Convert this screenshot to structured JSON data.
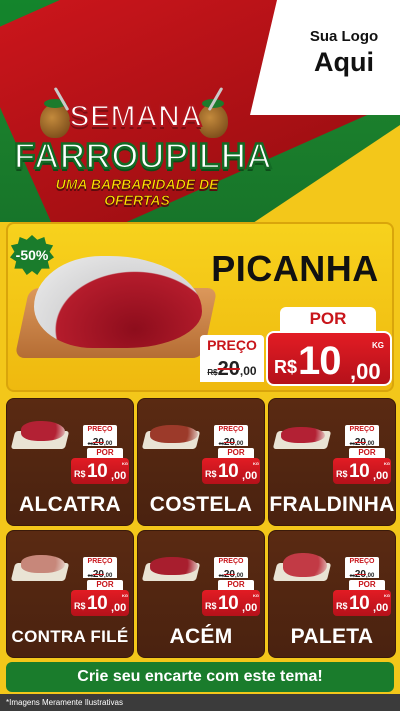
{
  "header": {
    "logo_line1": "Sua Logo",
    "logo_line2": "Aqui",
    "title_line1": "SEMANA",
    "title_line2": "FARROUPILHA",
    "subtitle": "UMA BARBARIDADE DE OFERTAS"
  },
  "hero": {
    "discount_badge": "-50%",
    "product": "PICANHA",
    "preco_label": "PREÇO",
    "por_label": "POR",
    "old_currency": "R$",
    "old_int": "20",
    "old_cents": ",00",
    "new_currency": "R$",
    "new_int": "10",
    "new_cents": ",00",
    "unit": "KG"
  },
  "products": [
    {
      "name": "ALCATRA",
      "preco_label": "PREÇO",
      "old_currency": "R$",
      "old_int": "20",
      "old_cents": ",00",
      "por_label": "POR",
      "new_currency": "R$",
      "new_int": "10",
      "new_cents": ",00",
      "unit": "KG"
    },
    {
      "name": "COSTELA",
      "preco_label": "PREÇO",
      "old_currency": "R$",
      "old_int": "20",
      "old_cents": ",00",
      "por_label": "POR",
      "new_currency": "R$",
      "new_int": "10",
      "new_cents": ",00",
      "unit": "KG"
    },
    {
      "name": "FRALDINHA",
      "preco_label": "PREÇO",
      "old_currency": "R$",
      "old_int": "20",
      "old_cents": ",00",
      "por_label": "POR",
      "new_currency": "R$",
      "new_int": "10",
      "new_cents": ",00",
      "unit": "KG"
    },
    {
      "name": "CONTRA FILÉ",
      "preco_label": "PREÇO",
      "old_currency": "R$",
      "old_int": "20",
      "old_cents": ",00",
      "por_label": "POR",
      "new_currency": "R$",
      "new_int": "10",
      "new_cents": ",00",
      "unit": "KG"
    },
    {
      "name": "ACÉM",
      "preco_label": "PREÇO",
      "old_currency": "R$",
      "old_int": "20",
      "old_cents": ",00",
      "por_label": "POR",
      "new_currency": "R$",
      "new_int": "10",
      "new_cents": ",00",
      "unit": "KG"
    },
    {
      "name": "PALETA",
      "preco_label": "PREÇO",
      "old_currency": "R$",
      "old_int": "20",
      "old_cents": ",00",
      "por_label": "POR",
      "new_currency": "R$",
      "new_int": "10",
      "new_cents": ",00",
      "unit": "KG"
    }
  ],
  "cta": "Crie seu encarte com este tema!",
  "disclaimer": "*Imagens Meramente Ilustrativas",
  "colors": {
    "brand_green": "#1a7c2c",
    "brand_red": "#c8151b",
    "brand_yellow": "#f3c71a",
    "card_brown": "#5a2a12"
  }
}
